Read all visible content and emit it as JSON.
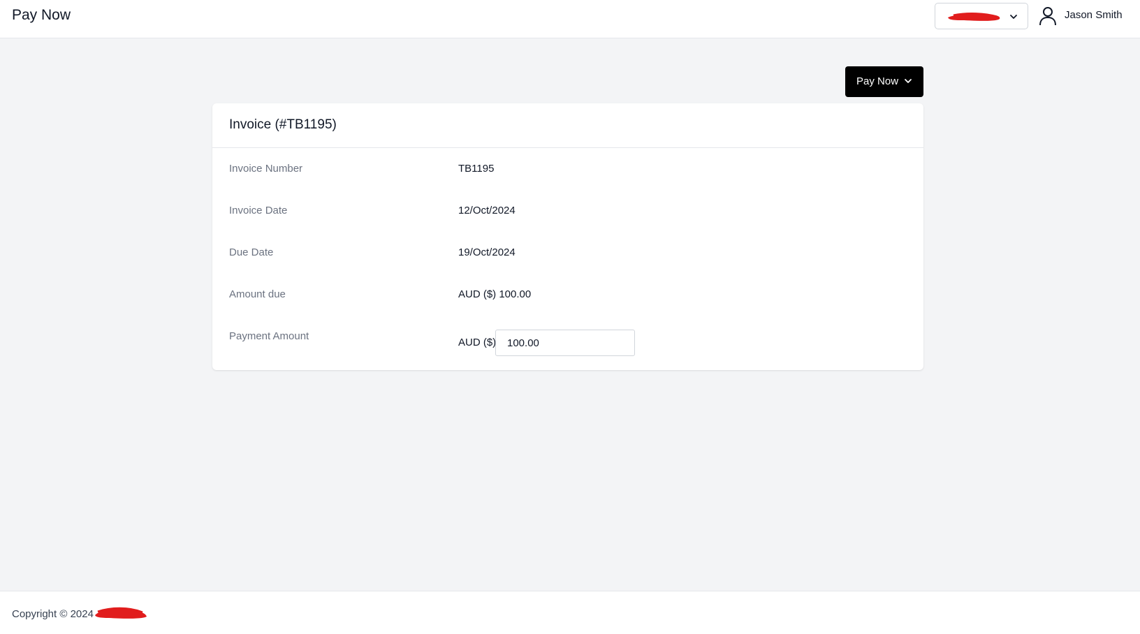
{
  "header": {
    "app_title": "Pay Now",
    "org_select_icon": "chevron-down-icon",
    "user_icon": "user-icon",
    "user_name": "Jason Smith"
  },
  "actions": {
    "pay_now_label": "Pay Now",
    "pay_now_icon": "chevron-down-icon",
    "pay_now_color": "#000000"
  },
  "invoice": {
    "title": "Invoice (#TB1195)",
    "rows": [
      {
        "label": "Invoice Number",
        "value": "TB1195"
      },
      {
        "label": "Invoice Date",
        "value": "12/Oct/2024"
      },
      {
        "label": "Due Date",
        "value": "19/Oct/2024"
      },
      {
        "label": "Amount due",
        "value": "AUD ($) 100.00"
      }
    ],
    "payment": {
      "label": "Payment Amount",
      "currency": "AUD ($)",
      "value": "100.00"
    }
  },
  "footer": {
    "copyright": "Copyright © 2024"
  },
  "colors": {
    "background": "#f3f4f6",
    "surface": "#ffffff",
    "redaction": "#e11d1d"
  }
}
